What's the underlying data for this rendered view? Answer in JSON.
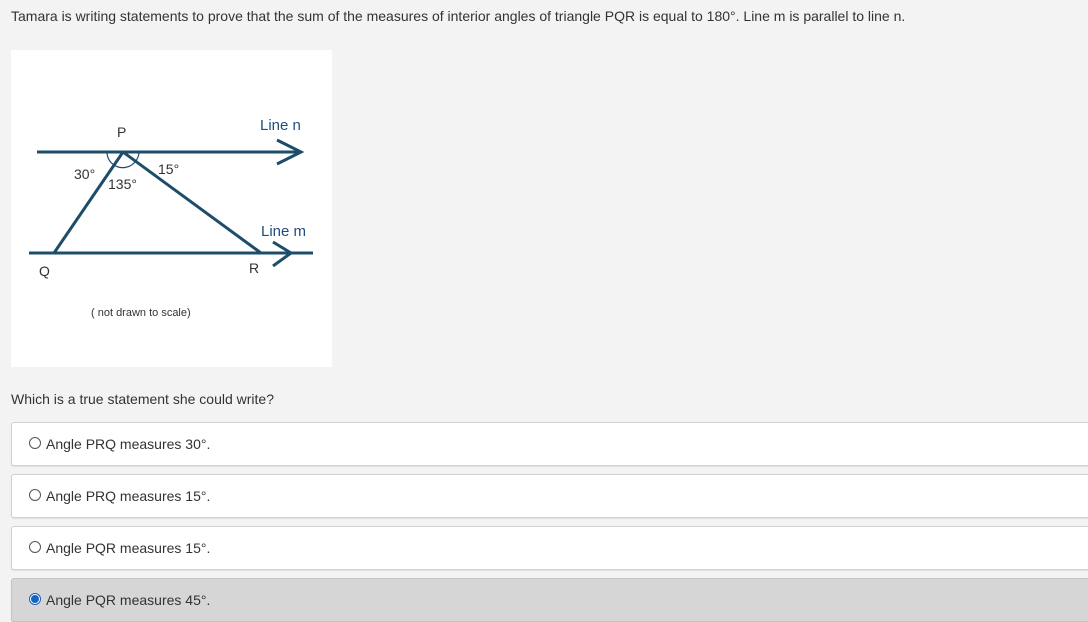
{
  "prompt": "Tamara is writing statements to prove that the sum of the measures of interior angles of triangle PQR is equal to 180°. Line m is parallel to line n.",
  "figure": {
    "labels": {
      "p": "P",
      "q": "Q",
      "r": "R",
      "line_n": "Line n",
      "line_m": "Line m",
      "angle_left": "30°",
      "angle_middle": "135°",
      "angle_right": "15°",
      "note": "( not drawn to scale)"
    },
    "colors": {
      "line": "#1e4d6b"
    }
  },
  "question": "Which is a true statement she could write?",
  "options": [
    {
      "label": "Angle PRQ measures 30°.",
      "selected": false
    },
    {
      "label": "Angle PRQ measures 15°.",
      "selected": false
    },
    {
      "label": "Angle PQR measures 15°.",
      "selected": false
    },
    {
      "label": "Angle PQR measures 45°.",
      "selected": true
    }
  ]
}
